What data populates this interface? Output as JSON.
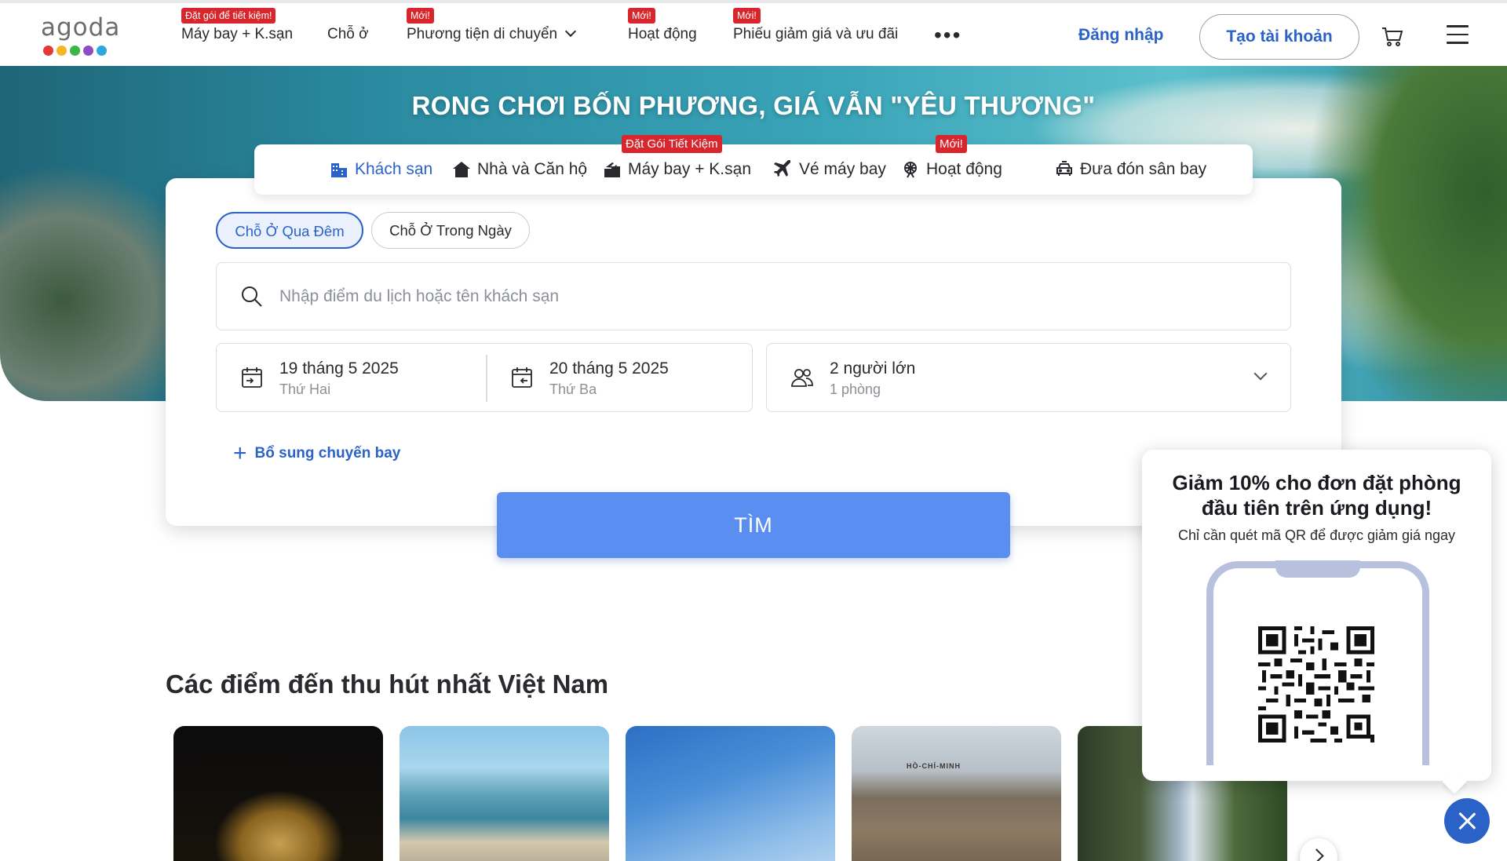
{
  "brand": {
    "logo_text": "agoda",
    "logo_dot_colors": [
      "#e23a3a",
      "#f4b529",
      "#3cb54a",
      "#8e4cc4",
      "#2fa6de"
    ],
    "accent": "#2b62c7",
    "badge_color": "#d9262c",
    "button_color": "#5a8ef0"
  },
  "nav": {
    "items": [
      {
        "label": "Máy bay + K.sạn",
        "badge": "Đặt gói để tiết kiệm!"
      },
      {
        "label": "Chỗ ở",
        "badge": ""
      },
      {
        "label": "Phương tiện di chuyển",
        "badge": "Mới!",
        "dropdown": true
      },
      {
        "label": "Hoạt động",
        "badge": "Mới!"
      },
      {
        "label": "Phiếu giảm giá và ưu đãi",
        "badge": "Mới!"
      }
    ],
    "more": "•••",
    "login": "Đăng nhập",
    "signup": "Tạo tài khoản"
  },
  "hero": {
    "title": "RONG CHƠI BỐN PHƯƠNG, GIÁ VẪN \"YÊU THƯƠNG\""
  },
  "search_tabs": [
    {
      "label": "Khách sạn",
      "icon": "hotel-icon",
      "active": true,
      "badge": ""
    },
    {
      "label": "Nhà và Căn hộ",
      "icon": "home-icon",
      "active": false,
      "badge": ""
    },
    {
      "label": "Máy bay + K.sạn",
      "icon": "flight-hotel-icon",
      "active": false,
      "badge": "Đặt Gói Tiết Kiệm"
    },
    {
      "label": "Vé máy bay",
      "icon": "plane-icon",
      "active": false,
      "badge": ""
    },
    {
      "label": "Hoạt động",
      "icon": "ferris-wheel-icon",
      "active": false,
      "badge": "Mới!"
    },
    {
      "label": "Đưa đón sân bay",
      "icon": "car-icon",
      "active": false,
      "badge": ""
    }
  ],
  "stay_type": {
    "overnight": "Chỗ Ở Qua Đêm",
    "day_use": "Chỗ Ở Trong Ngày"
  },
  "search": {
    "placeholder": "Nhập điểm du lịch hoặc tên khách sạn",
    "value": ""
  },
  "dates": {
    "checkin": {
      "date": "19 tháng 5 2025",
      "weekday": "Thứ Hai"
    },
    "checkout": {
      "date": "20 tháng 5 2025",
      "weekday": "Thứ Ba"
    }
  },
  "guests": {
    "adults": "2 người lớn",
    "rooms": "1 phòng"
  },
  "add_flight": "Bổ sung chuyến bay",
  "search_button": "TÌM",
  "destinations": {
    "title": "Các điểm đến thu hút nhất Việt Nam",
    "mausoleum_sign": "HỒ-CHÍ-MINH"
  },
  "popup": {
    "title_line1": "Giảm 10% cho đơn đặt phòng",
    "title_line2": "đầu tiên trên ứng dụng!",
    "subtitle": "Chỉ cần quét mã QR để được giảm giá ngay"
  }
}
